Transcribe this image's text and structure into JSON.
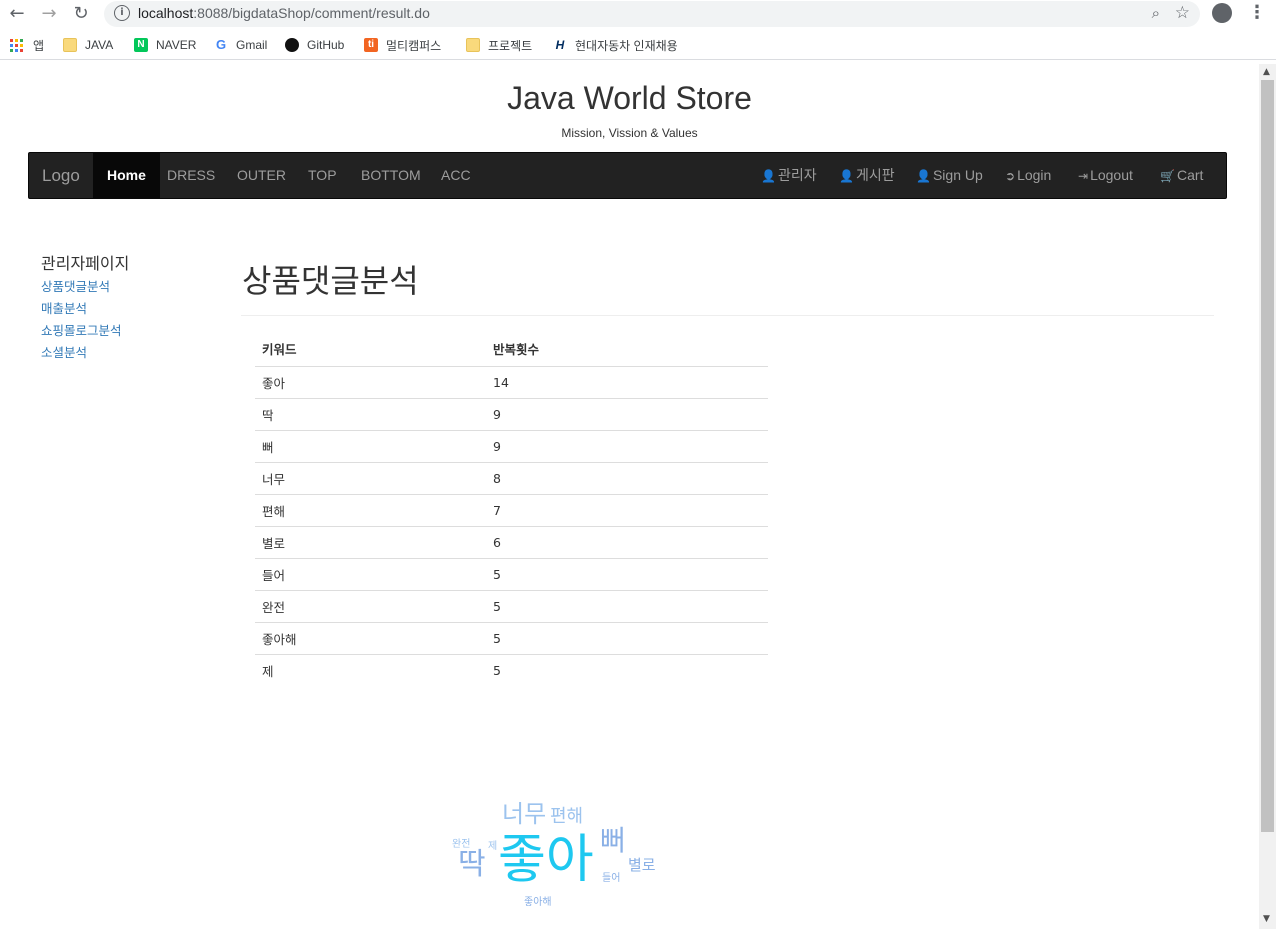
{
  "browser": {
    "url_host": "localhost",
    "url_path": ":8088/bigdataShop/comment/result.do",
    "bookmarks": [
      {
        "label": "앱",
        "icon": "apps-grid-icon"
      },
      {
        "label": "JAVA",
        "icon": "folder-icon"
      },
      {
        "label": "NAVER",
        "icon": "naver-icon"
      },
      {
        "label": "Gmail",
        "icon": "google-icon"
      },
      {
        "label": "GitHub",
        "icon": "github-icon"
      },
      {
        "label": "멀티캠퍼스",
        "icon": "multicampus-icon"
      },
      {
        "label": "프로젝트",
        "icon": "folder-icon"
      },
      {
        "label": "현대자동차 인재채용",
        "icon": "hyundai-icon"
      }
    ]
  },
  "header": {
    "title": "Java World Store",
    "subtitle": "Mission, Vission & Values"
  },
  "navbar": {
    "brand": "Logo",
    "left": [
      "Home",
      "DRESS",
      "OUTER",
      "TOP",
      "BOTTOM",
      "ACC"
    ],
    "active": "Home",
    "right": [
      {
        "label": "관리자",
        "icon": "user-icon"
      },
      {
        "label": "게시판",
        "icon": "user-icon"
      },
      {
        "label": "Sign Up",
        "icon": "user-icon"
      },
      {
        "label": "Login",
        "icon": "login-icon"
      },
      {
        "label": "Logout",
        "icon": "logout-icon"
      },
      {
        "label": "Cart",
        "icon": "cart-icon"
      }
    ]
  },
  "sidebar": {
    "title": "관리자페이지",
    "links": [
      "상품댓글분석",
      "매출분석",
      "쇼핑몰로그분석",
      "소셜분석"
    ]
  },
  "main": {
    "title": "상품댓글분석",
    "table": {
      "headers": [
        "키워드",
        "반복횟수"
      ],
      "rows": [
        [
          "좋아",
          "14"
        ],
        [
          "딱",
          "9"
        ],
        [
          "뻐",
          "9"
        ],
        [
          "너무",
          "8"
        ],
        [
          "편해",
          "7"
        ],
        [
          "별로",
          "6"
        ],
        [
          "들어",
          "5"
        ],
        [
          "완전",
          "5"
        ],
        [
          "좋아해",
          "5"
        ],
        [
          "제",
          "5"
        ]
      ]
    }
  },
  "wordcloud": {
    "words": [
      "좋아",
      "딱",
      "뻐",
      "너무",
      "편해",
      "별로",
      "들어",
      "완전",
      "좋아해",
      "제"
    ],
    "colors": {
      "primary": "#1ec8f0",
      "secondary": "#8ab0e6",
      "tertiary": "#9cc3ee"
    }
  },
  "colors": {
    "navbar_bg": "#222222",
    "link": "#337ab7"
  }
}
